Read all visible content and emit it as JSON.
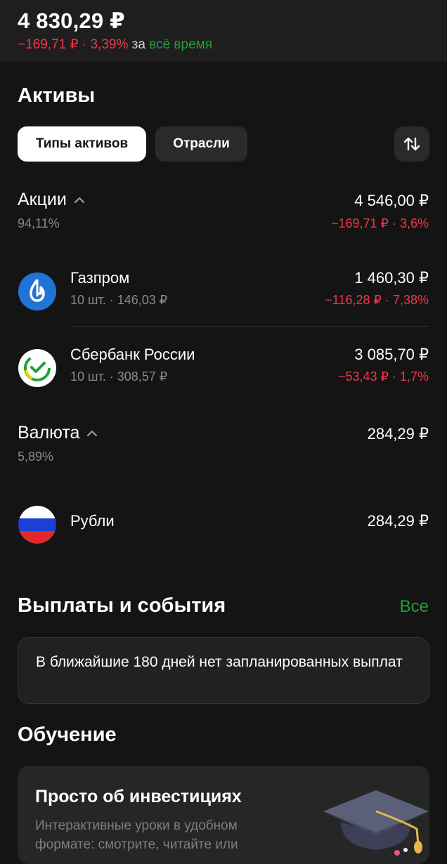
{
  "header": {
    "total": "4 830,29 ₽",
    "change_amount": "−169,71 ₽ · 3,39%",
    "change_for": "за",
    "change_period": "всё время"
  },
  "assets": {
    "title": "Активы",
    "tabs": [
      "Типы активов",
      "Отрасли"
    ],
    "sort_icon": "sort-arrows-icon"
  },
  "groups": [
    {
      "name": "Акции",
      "percent": "94,11%",
      "amount": "4 546,00 ₽",
      "delta": "−169,71 ₽ · 3,6%",
      "items": [
        {
          "name": "Газпром",
          "sub": "10 шт. · 146,03 ₽",
          "amount": "1 460,30 ₽",
          "delta": "−116,28 ₽ · 7,38%",
          "icon": "gazprom-logo"
        },
        {
          "name": "Сбербанк России",
          "sub": "10 шт. · 308,57 ₽",
          "amount": "3 085,70 ₽",
          "delta": "−53,43 ₽ · 1,7%",
          "icon": "sberbank-logo"
        }
      ]
    },
    {
      "name": "Валюта",
      "percent": "5,89%",
      "amount": "284,29 ₽",
      "items": [
        {
          "name": "Рубли",
          "amount": "284,29 ₽",
          "icon": "russia-flag-icon"
        }
      ]
    }
  ],
  "events": {
    "title": "Выплаты и события",
    "all_link": "Все",
    "empty_text": "В ближайшие 180 дней нет запланированных выплат"
  },
  "learning": {
    "title": "Обучение",
    "card_title": "Просто об инвестициях",
    "card_desc": "Интерактивные уроки в удобном формате: смотрите, читайте или"
  },
  "colors": {
    "background": "#141414",
    "negative": "#f2364a",
    "positive": "#21a038",
    "card": "#212121"
  }
}
